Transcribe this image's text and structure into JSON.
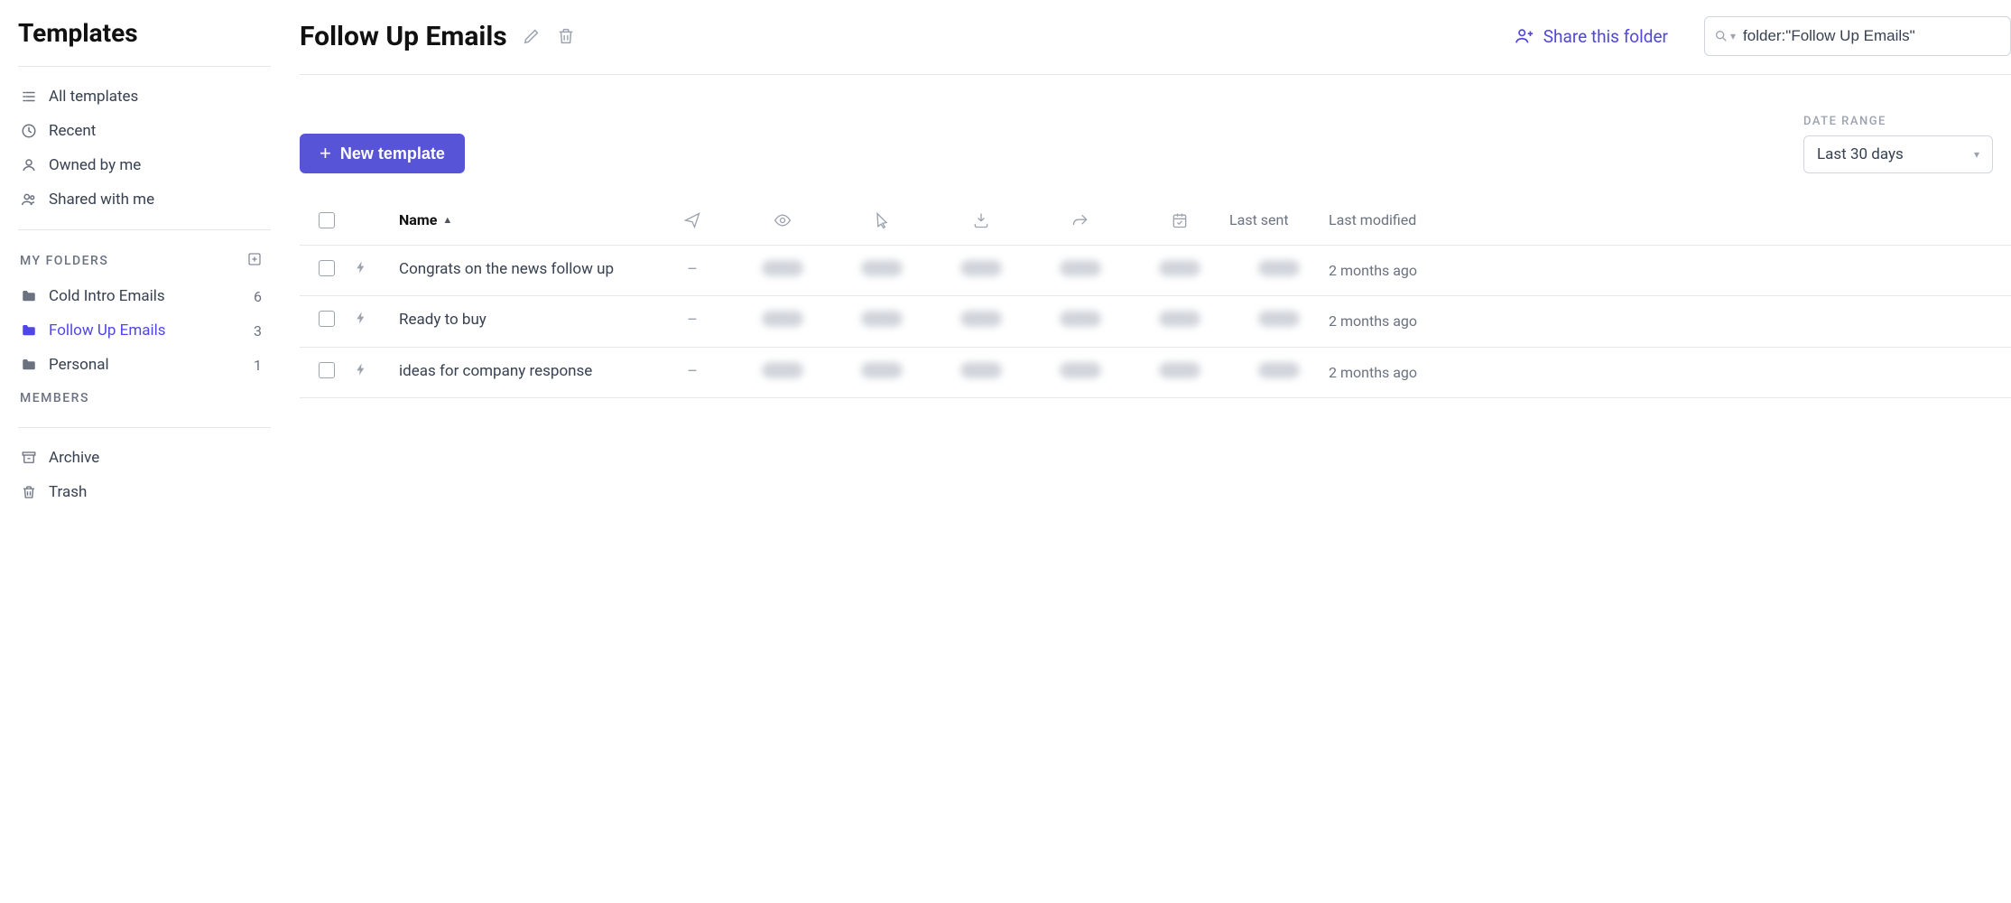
{
  "sidebar": {
    "title": "Templates",
    "nav": [
      {
        "label": "All templates"
      },
      {
        "label": "Recent"
      },
      {
        "label": "Owned by me"
      },
      {
        "label": "Shared with me"
      }
    ],
    "my_folders_heading": "MY FOLDERS",
    "folders": [
      {
        "label": "Cold Intro Emails",
        "count": "6",
        "active": false
      },
      {
        "label": "Follow Up Emails",
        "count": "3",
        "active": true
      },
      {
        "label": "Personal",
        "count": "1",
        "active": false
      }
    ],
    "members_heading": "MEMBERS",
    "bottom": [
      {
        "label": "Archive"
      },
      {
        "label": "Trash"
      }
    ]
  },
  "header": {
    "title": "Follow Up Emails",
    "share_label": "Share this folder",
    "search_value": "folder:\"Follow Up Emails\""
  },
  "toolbar": {
    "new_template_label": "New template",
    "date_range_label": "DATE RANGE",
    "date_range_value": "Last 30 days"
  },
  "table": {
    "columns": {
      "name": "Name",
      "last_sent": "Last sent",
      "last_modified": "Last modified"
    },
    "rows": [
      {
        "name": "Congrats on the news follow up",
        "modified": "2 months ago"
      },
      {
        "name": "Ready to buy",
        "modified": "2 months ago"
      },
      {
        "name": "ideas for company response",
        "modified": "2 months ago"
      }
    ]
  }
}
